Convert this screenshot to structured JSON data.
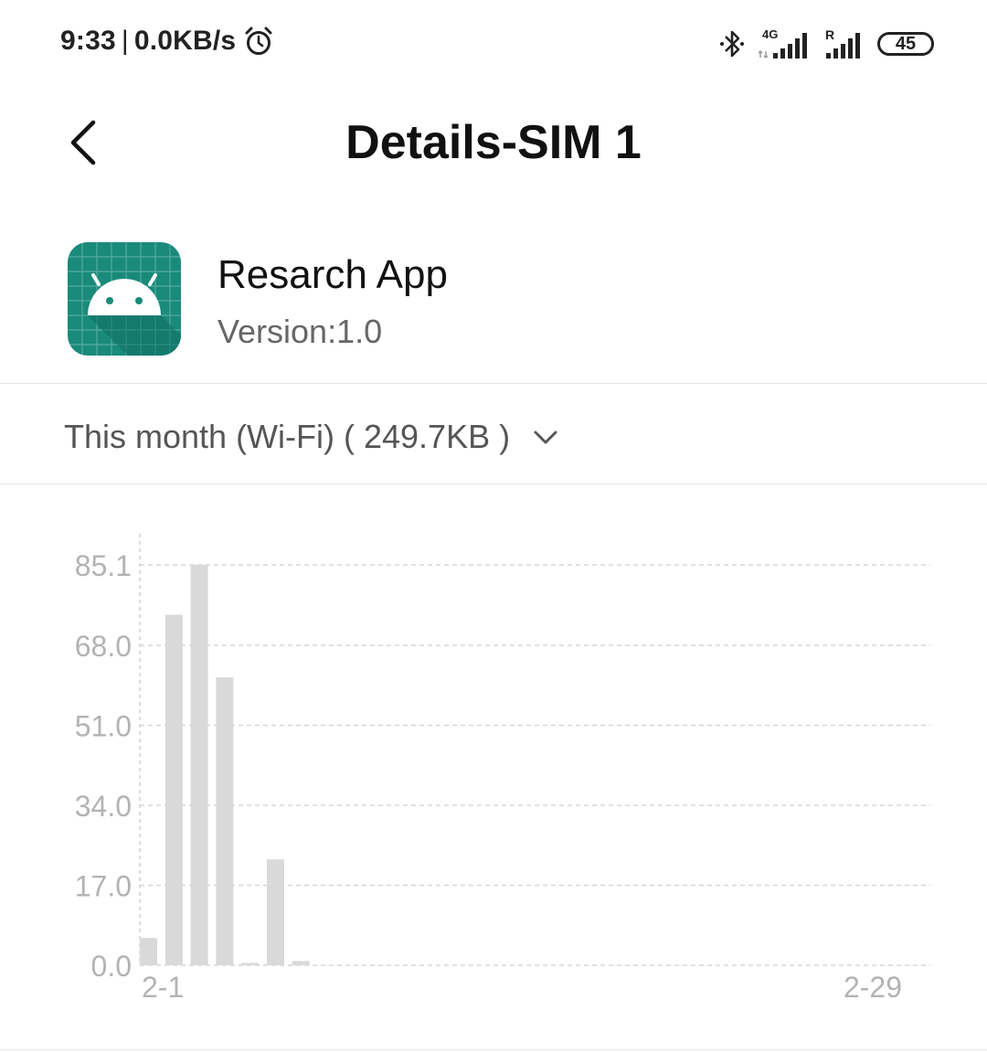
{
  "status_bar": {
    "time": "9:33",
    "network_speed": "0.0KB/s",
    "separator": "|",
    "network_type": "4G",
    "roaming": "R",
    "battery": "45",
    "battery_level": 0.45,
    "icons": [
      "alarm-icon",
      "bluetooth-icon",
      "signal-4g-icon",
      "signal-roaming-icon",
      "battery-icon"
    ]
  },
  "header": {
    "title": "Details-SIM 1",
    "back_icon": "chevron-left-icon"
  },
  "app": {
    "name": "Resarch App",
    "version": "Version:1.0",
    "icon": "android-app-icon",
    "icon_colors": {
      "background": "#1a8a7a",
      "grid": "#5fb3a8",
      "robot": "#ffffff"
    }
  },
  "period": {
    "label": "This month (Wi-Fi) ( 249.7KB )",
    "icon": "chevron-down-icon"
  },
  "chart_data": {
    "type": "bar",
    "x_start_label": "2-1",
    "x_end_label": "2-29",
    "days": 29,
    "yticks": [
      "0.0",
      "17.0",
      "34.0",
      "51.0",
      "68.0",
      "85.1"
    ],
    "ylim": [
      0,
      85.1
    ],
    "values": [
      5.8,
      74.5,
      85.1,
      61.2,
      0.5,
      22.5,
      0.9,
      0,
      0,
      0,
      0,
      0,
      0,
      0,
      0,
      0,
      0,
      0,
      0,
      0,
      0,
      0,
      0,
      0,
      0,
      0,
      0,
      0,
      0
    ],
    "bar_color": "#d9d9d9",
    "grid": true,
    "grid_style": "dashed"
  }
}
